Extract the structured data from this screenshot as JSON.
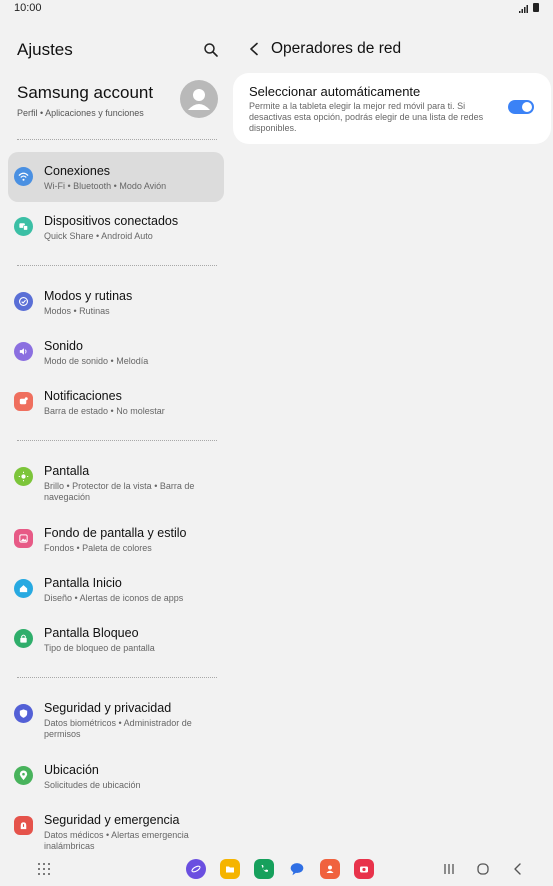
{
  "status": {
    "time": "10:00"
  },
  "left": {
    "title": "Ajustes",
    "account": {
      "name": "Samsung account",
      "sub": "Perfil • Aplicaciones y funciones"
    },
    "items": [
      {
        "title": "Conexiones",
        "sub": "Wi-Fi • Bluetooth • Modo Avión",
        "icon": "wifi-icon",
        "color": "#4a90e2"
      },
      {
        "title": "Dispositivos conectados",
        "sub": "Quick Share • Android Auto",
        "icon": "devices-icon",
        "color": "#3bbfa5"
      },
      {
        "title": "Modos y rutinas",
        "sub": "Modos • Rutinas",
        "icon": "check-circle-icon",
        "color": "#5a6fd6"
      },
      {
        "title": "Sonido",
        "sub": "Modo de sonido • Melodía",
        "icon": "volume-icon",
        "color": "#8b6fe0"
      },
      {
        "title": "Notificaciones",
        "sub": "Barra de estado • No molestar",
        "icon": "notification-icon",
        "color": "#ef6f5e"
      },
      {
        "title": "Pantalla",
        "sub": "Brillo • Protector de la vista • Barra de navegación",
        "icon": "brightness-icon",
        "color": "#7cc53a"
      },
      {
        "title": "Fondo de pantalla y estilo",
        "sub": "Fondos • Paleta de colores",
        "icon": "wallpaper-icon",
        "color": "#e75a86"
      },
      {
        "title": "Pantalla Inicio",
        "sub": "Diseño • Alertas de iconos de apps",
        "icon": "home-icon",
        "color": "#27a9e1"
      },
      {
        "title": "Pantalla Bloqueo",
        "sub": "Tipo de bloqueo de pantalla",
        "icon": "lock-icon",
        "color": "#2fae6b"
      },
      {
        "title": "Seguridad y privacidad",
        "sub": "Datos biométricos • Administrador de permisos",
        "icon": "shield-icon",
        "color": "#5360d6"
      },
      {
        "title": "Ubicación",
        "sub": "Solicitudes de ubicación",
        "icon": "location-icon",
        "color": "#48b35c"
      },
      {
        "title": "Seguridad y emergencia",
        "sub": "Datos médicos • Alertas emergencia inalámbricas",
        "icon": "emergency-icon",
        "color": "#e5534b"
      }
    ]
  },
  "right": {
    "title": "Operadores de red",
    "auto_select": {
      "title": "Seleccionar automáticamente",
      "desc": "Permite a la tableta elegir la mejor red móvil para ti. Si desactivas esta opción, podrás elegir de una lista de redes disponibles.",
      "enabled": true
    }
  },
  "colors": {
    "accent": "#3b82f6",
    "selected_bg": "#dcdcdc"
  }
}
